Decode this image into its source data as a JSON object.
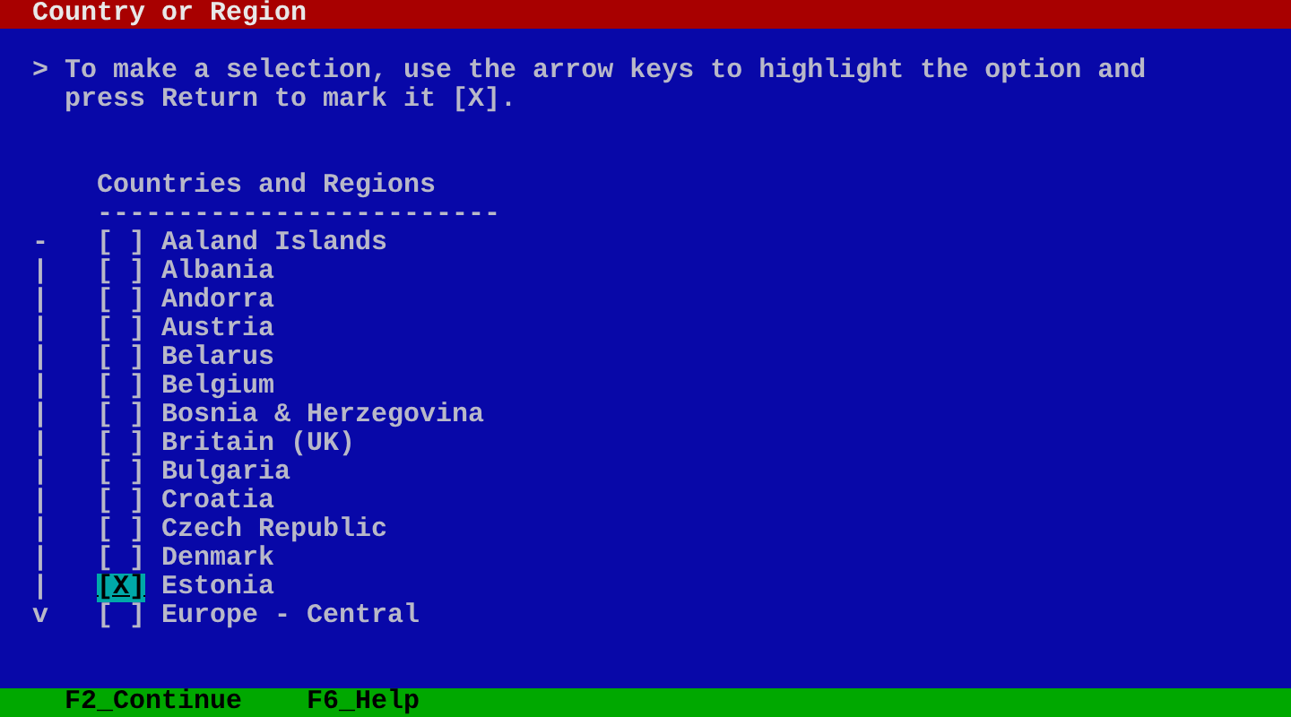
{
  "window": {
    "title": "Country or Region"
  },
  "instructions": {
    "prompt": ">",
    "lines": [
      "To make a selection, use the arrow keys to highlight the option and",
      "press Return to mark it [X]."
    ]
  },
  "list": {
    "heading": "Countries and Regions",
    "rule": "-------------------------",
    "check_glyphs": {
      "checked": "[X]",
      "unchecked": "[ ]"
    },
    "items": [
      {
        "scroll_mark": "-",
        "name": "Aaland Islands",
        "checked": false,
        "selected": false
      },
      {
        "scroll_mark": "|",
        "name": "Albania",
        "checked": false,
        "selected": false
      },
      {
        "scroll_mark": "|",
        "name": "Andorra",
        "checked": false,
        "selected": false
      },
      {
        "scroll_mark": "|",
        "name": "Austria",
        "checked": false,
        "selected": false
      },
      {
        "scroll_mark": "|",
        "name": "Belarus",
        "checked": false,
        "selected": false
      },
      {
        "scroll_mark": "|",
        "name": "Belgium",
        "checked": false,
        "selected": false
      },
      {
        "scroll_mark": "|",
        "name": "Bosnia & Herzegovina",
        "checked": false,
        "selected": false
      },
      {
        "scroll_mark": "|",
        "name": "Britain (UK)",
        "checked": false,
        "selected": false
      },
      {
        "scroll_mark": "|",
        "name": "Bulgaria",
        "checked": false,
        "selected": false
      },
      {
        "scroll_mark": "|",
        "name": "Croatia",
        "checked": false,
        "selected": false
      },
      {
        "scroll_mark": "|",
        "name": "Czech Republic",
        "checked": false,
        "selected": false
      },
      {
        "scroll_mark": "|",
        "name": "Denmark",
        "checked": false,
        "selected": false
      },
      {
        "scroll_mark": "|",
        "name": "Estonia",
        "checked": true,
        "selected": true
      },
      {
        "scroll_mark": "v",
        "name": "Europe - Central",
        "checked": false,
        "selected": false
      }
    ]
  },
  "status_bar": {
    "keys": [
      "F2_Continue",
      "F6_Help"
    ]
  }
}
